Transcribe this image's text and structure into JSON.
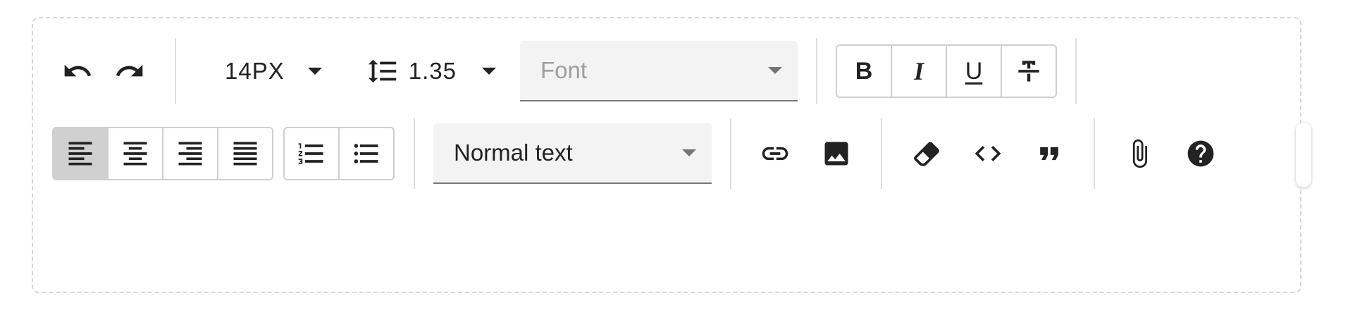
{
  "toolbar": {
    "font_size": "14PX",
    "line_height": "1.35",
    "font_placeholder": "Font",
    "block_format": "Normal text",
    "format_buttons": {
      "bold": "B",
      "italic": "I",
      "underline": "U"
    }
  }
}
